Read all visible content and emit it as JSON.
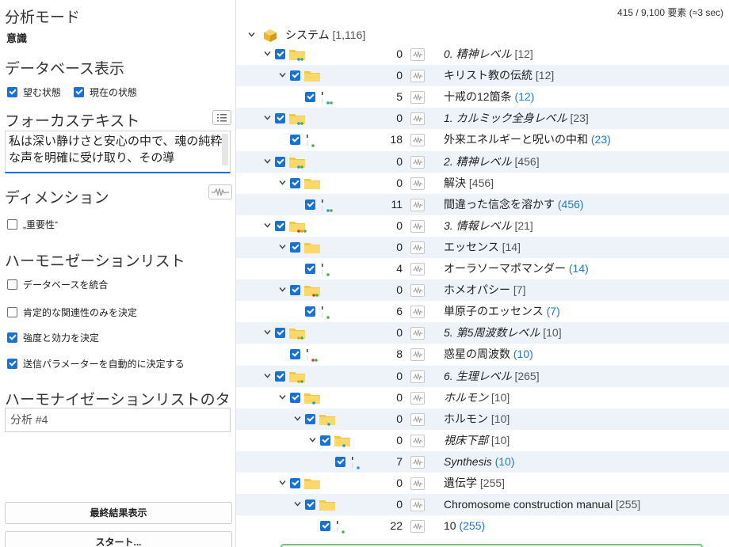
{
  "left": {
    "analysis_mode_title": "分析モード",
    "analysis_mode_value": "意識",
    "db_view_title": "データベース表示",
    "db_view": {
      "desired": "望む状態",
      "current": "現在の状態"
    },
    "focus_title": "フォーカステキスト",
    "focus_text": "私は深い静けさと安心の中で、魂の純粋な声を明確に受け取り、その導",
    "dimension_title": "ディメンション",
    "dimension_option": "„重要性“",
    "harmonization_title": "ハーモニゼーションリスト",
    "harmonization_options": [
      {
        "label": "データベースを統合",
        "checked": false
      },
      {
        "label": "肯定的な関連性のみを決定",
        "checked": false
      },
      {
        "label": "強度と効力を決定",
        "checked": true
      },
      {
        "label": "送信パラメーターを自動的に決定する",
        "checked": true
      }
    ],
    "list_title_heading": "ハーモナイゼーションリストのタイトル",
    "list_title_value": "分析 #4",
    "final_result_button": "最終結果表示",
    "start_button": "スタート..."
  },
  "tree": {
    "counter": "415 / 9,100 要素 (≈3 sec)",
    "root": {
      "label": "システム",
      "count": "[1,116]"
    },
    "rows": [
      {
        "depth": 1,
        "kind": "folder",
        "dots": [
          "#1e9bd7",
          "#43b043"
        ],
        "num": "0",
        "label": "0. 精神レベル",
        "italic": true,
        "count": "[12]",
        "alt": false
      },
      {
        "depth": 2,
        "kind": "folder",
        "dots": [],
        "num": "0",
        "label": "キリスト教の伝統",
        "italic": false,
        "count": "[12]",
        "alt": true
      },
      {
        "depth": 3,
        "kind": "doc",
        "dots": [
          "#1e9bd7",
          "#43b043"
        ],
        "num": "5",
        "label": "十戒の12箇条",
        "italic": false,
        "count": "(12)",
        "link": true,
        "alt": false
      },
      {
        "depth": 1,
        "kind": "folder",
        "dots": [
          "#1e9bd7",
          "#43b043"
        ],
        "num": "0",
        "label": "1. カルミック全身レベル",
        "italic": true,
        "count": "[23]",
        "alt": true
      },
      {
        "depth": 2,
        "kind": "doc",
        "dots": [
          "#43b043"
        ],
        "num": "18",
        "label": "外来エネルギーと呪いの中和",
        "italic": false,
        "count": "(23)",
        "link": true,
        "alt": false
      },
      {
        "depth": 1,
        "kind": "folder",
        "dots": [
          "#1e9bd7",
          "#43b043"
        ],
        "num": "0",
        "label": "2. 精神レベル",
        "italic": true,
        "count": "[456]",
        "alt": true
      },
      {
        "depth": 2,
        "kind": "folder",
        "dots": [],
        "num": "0",
        "label": "解決",
        "italic": false,
        "count": "[456]",
        "alt": false
      },
      {
        "depth": 3,
        "kind": "doc",
        "dots": [
          "#1e9bd7",
          "#43b043"
        ],
        "num": "11",
        "label": "間違った信念を溶かす",
        "italic": false,
        "count": "(456)",
        "link": true,
        "alt": true
      },
      {
        "depth": 1,
        "kind": "folder",
        "dots": [
          "#d9332b",
          "#e0a21a",
          "#43b043"
        ],
        "num": "0",
        "label": "3. 情報レベル",
        "italic": true,
        "count": "[21]",
        "alt": false
      },
      {
        "depth": 2,
        "kind": "folder",
        "dots": [],
        "num": "0",
        "label": "エッセンス",
        "italic": false,
        "count": "[14]",
        "alt": true
      },
      {
        "depth": 3,
        "kind": "doc",
        "dots": [
          "#43b043"
        ],
        "num": "4",
        "label": "オーラソーマポマンダー",
        "italic": false,
        "count": "(14)",
        "link": true,
        "alt": false
      },
      {
        "depth": 2,
        "kind": "folder",
        "dots": [
          "#d9332b",
          "#43b043"
        ],
        "num": "0",
        "label": "ホメオパシー",
        "italic": false,
        "count": "[7]",
        "alt": true
      },
      {
        "depth": 3,
        "kind": "doc",
        "dots": [
          "#43b043"
        ],
        "num": "6",
        "label": "単原子のエッセンス",
        "italic": false,
        "count": "(7)",
        "link": true,
        "alt": false
      },
      {
        "depth": 1,
        "kind": "folder",
        "dots": [
          "#e0a21a",
          "#43b043"
        ],
        "num": "0",
        "label": "5. 第5周波数レベル",
        "italic": true,
        "count": "[10]",
        "alt": true
      },
      {
        "depth": 2,
        "kind": "doc",
        "dots": [
          "#d9332b",
          "#43b043"
        ],
        "num": "8",
        "label": "惑星の周波数",
        "italic": false,
        "count": "(10)",
        "link": true,
        "alt": false
      },
      {
        "depth": 1,
        "kind": "folder",
        "dots": [
          "#e0a21a",
          "#43b043"
        ],
        "num": "0",
        "label": "6. 生理レベル",
        "italic": true,
        "count": "[265]",
        "alt": true
      },
      {
        "depth": 2,
        "kind": "folder",
        "dots": [
          "#1e9bd7"
        ],
        "num": "0",
        "label": "ホルモン",
        "italic": true,
        "count": "[10]",
        "alt": false
      },
      {
        "depth": 3,
        "kind": "folder",
        "dots": [
          "#1e9bd7"
        ],
        "num": "0",
        "label": "ホルモン",
        "italic": false,
        "count": "[10]",
        "alt": true
      },
      {
        "depth": 4,
        "kind": "folder",
        "dots": [
          "#1e9bd7"
        ],
        "num": "0",
        "label": "視床下部",
        "italic": true,
        "count": "[10]",
        "alt": false
      },
      {
        "depth": 5,
        "kind": "doc",
        "dots": [
          "#1e9bd7"
        ],
        "num": "7",
        "label": "Synthesis",
        "italic": true,
        "count": "(10)",
        "link": true,
        "alt": true
      },
      {
        "depth": 2,
        "kind": "folder",
        "dots": [],
        "num": "0",
        "label": "遺伝学",
        "italic": false,
        "count": "[255]",
        "alt": false
      },
      {
        "depth": 3,
        "kind": "folder",
        "dots": [],
        "num": "0",
        "label": "Chromosome construction manual",
        "italic": false,
        "count": "[255]",
        "alt": true
      },
      {
        "depth": 4,
        "kind": "doc",
        "dots": [
          "#43b043"
        ],
        "num": "22",
        "label": "10",
        "italic": false,
        "count": "(255)",
        "link": true,
        "alt": false
      }
    ]
  },
  "colors": {
    "accent": "#1872d4",
    "link": "#1c7ac6",
    "folder": "#f5c842",
    "row_alt": "#eef3f9"
  }
}
